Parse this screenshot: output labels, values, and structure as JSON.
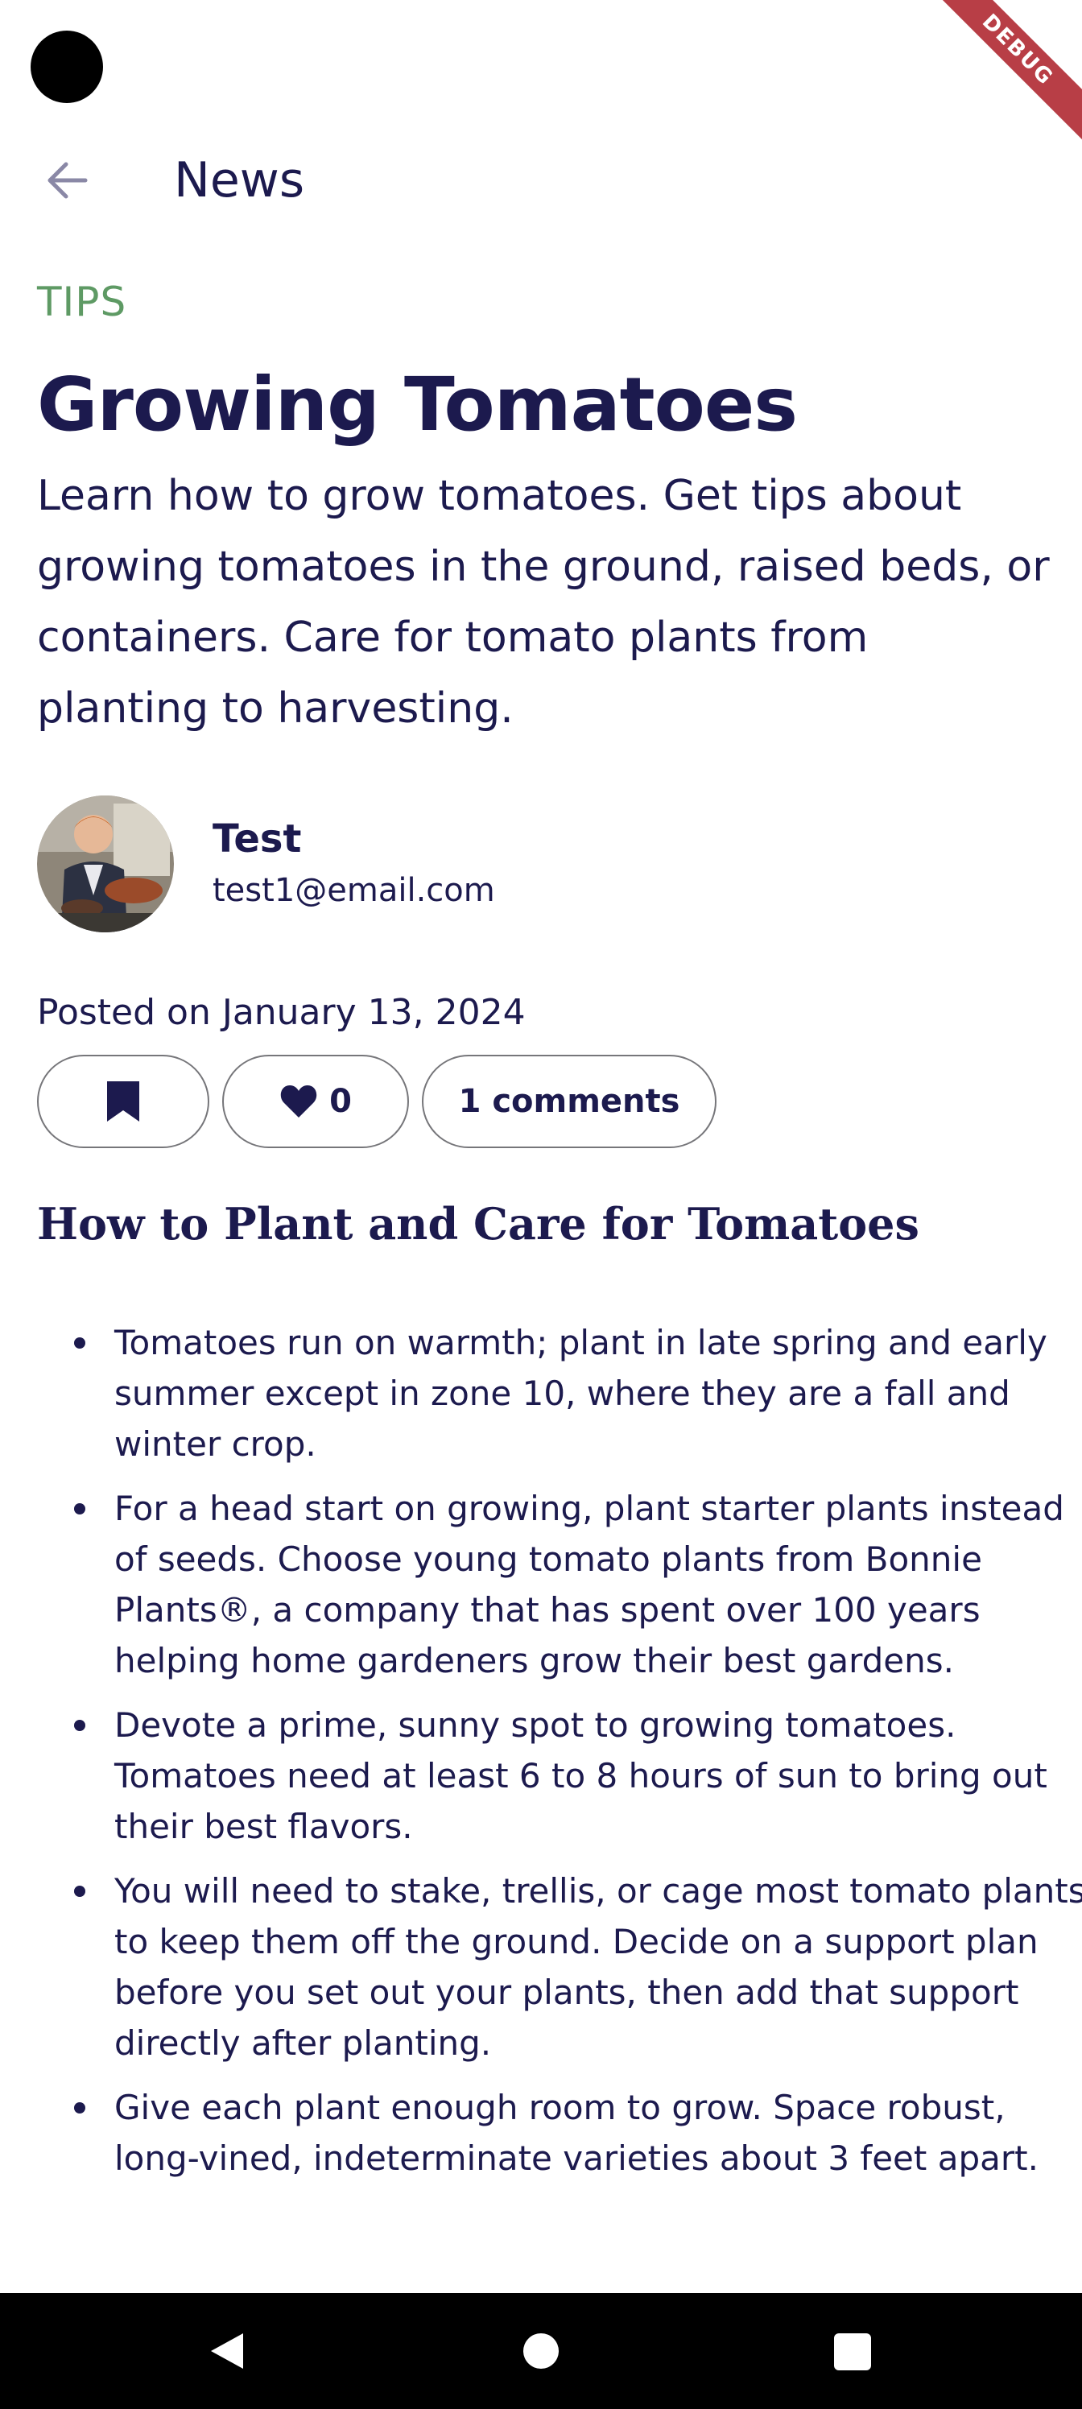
{
  "debug_banner": "DEBUG",
  "app_bar": {
    "title": "News",
    "back_icon": "arrow-left-icon"
  },
  "article": {
    "category": "TIPS",
    "title": "Growing Tomatoes",
    "summary": "Learn how to grow tomatoes. Get tips about growing tomatoes in the ground, raised beds, or containers. Care for tomato plants from planting to harvesting.",
    "author": {
      "name": "Test",
      "email": "test1@email.com",
      "avatar": "author-photo"
    },
    "posted": "Posted on January 13, 2024",
    "actions": {
      "bookmark_icon": "bookmark-icon",
      "like_icon": "heart-icon",
      "like_count": "0",
      "comments_label": "1 comments"
    },
    "section_heading": "How to Plant and Care for Tomatoes",
    "bullets": [
      "Tomatoes run on warmth; plant in late spring and early summer except in zone 10, where they are a fall and winter crop.",
      "For a head start on growing, plant starter plants instead of seeds. Choose young tomato plants from Bonnie Plants®, a company that has spent over 100 years helping home gardeners grow their best gardens.",
      "Devote a prime, sunny spot to growing tomatoes. Tomatoes need at least 6 to 8 hours of sun to bring out their best flavors.",
      "You will need to stake, trellis, or cage most tomato plants to keep them off the ground. Decide on a support plan before you set out your plants, then add that support directly after planting.",
      "Give each plant enough room to grow. Space robust, long-vined, indeterminate varieties about 3 feet apart."
    ]
  },
  "system_nav": {
    "back_icon": "triangle-back-icon",
    "home_icon": "circle-home-icon",
    "recents_icon": "square-recents-icon"
  },
  "colors": {
    "primary": "#1c1a4e",
    "category": "#5e9a64",
    "outline": "#76767a",
    "debug": "#b83e46"
  }
}
